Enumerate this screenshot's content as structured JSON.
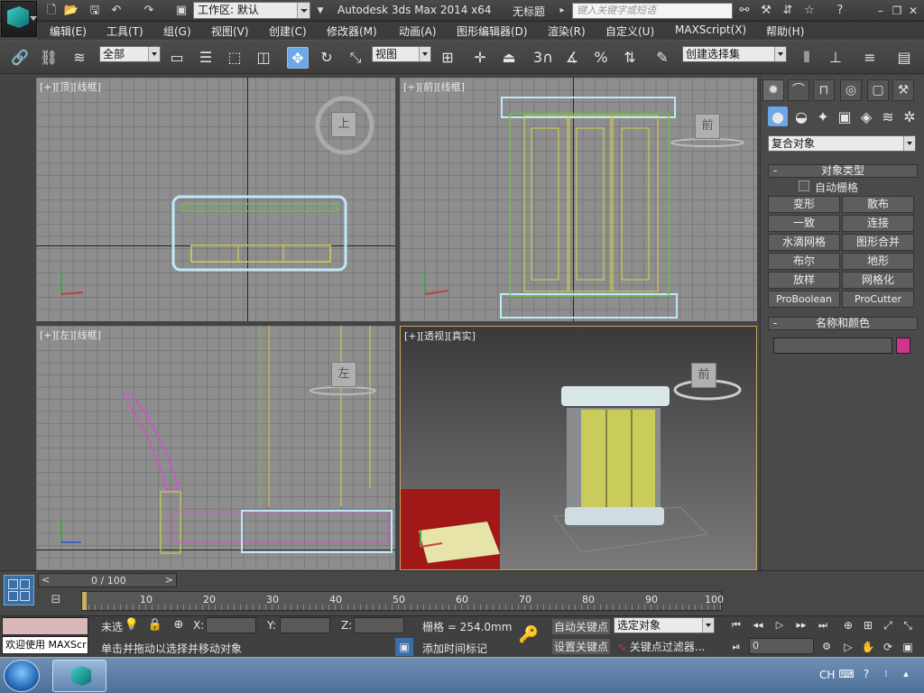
{
  "app": {
    "title": "Autodesk 3ds Max  2014 x64",
    "document": "无标题",
    "workspace": "工作区: 默认",
    "search_placeholder": "键入关键字或短语"
  },
  "menu": [
    "编辑(E)",
    "工具(T)",
    "组(G)",
    "视图(V)",
    "创建(C)",
    "修改器(M)",
    "动画(A)",
    "图形编辑器(D)",
    "渲染(R)",
    "自定义(U)",
    "MAXScript(X)",
    "帮助(H)"
  ],
  "toolbar": {
    "filter": "全部",
    "ref_coord": "视图",
    "selection_set": "创建选择集",
    "angle_snap_value": "3"
  },
  "viewports": {
    "top": {
      "label": "[+][顶][线框]",
      "cube": "上"
    },
    "front": {
      "label": "[+][前][线框]",
      "cube": "前"
    },
    "left": {
      "label": "[+][左][线框]",
      "cube": "左"
    },
    "persp": {
      "label": "[+][透视][真实]",
      "cube": "前"
    }
  },
  "command_panel": {
    "category": "复合对象",
    "object_type_header": "对象类型",
    "autogrid": "自动栅格",
    "buttons": [
      "变形",
      "散布",
      "一致",
      "连接",
      "水滴网格",
      "图形合并",
      "布尔",
      "地形",
      "放样",
      "网格化",
      "ProBoolean",
      "ProCutter"
    ],
    "name_color_header": "名称和颜色",
    "object_color": "#d0358c"
  },
  "timeline": {
    "frame": "0 / 100",
    "ticks": [
      "10",
      "20",
      "30",
      "40",
      "50",
      "60",
      "70",
      "80",
      "90",
      "100"
    ]
  },
  "status": {
    "script_prompt": "欢迎使用 MAXScr",
    "selection": "未选",
    "message": "单击并拖动以选择并移动对象",
    "add_time_tag": "添加时间标记",
    "x_label": "X:",
    "y_label": "Y:",
    "z_label": "Z:",
    "grid": "栅格 = 254.0mm",
    "auto_key": "自动关键点",
    "set_key": "设置关键点",
    "key_mode": "选定对象",
    "key_filters": "关键点过滤器...",
    "frame_field": "0"
  },
  "taskbar": {
    "lang": "CH"
  }
}
